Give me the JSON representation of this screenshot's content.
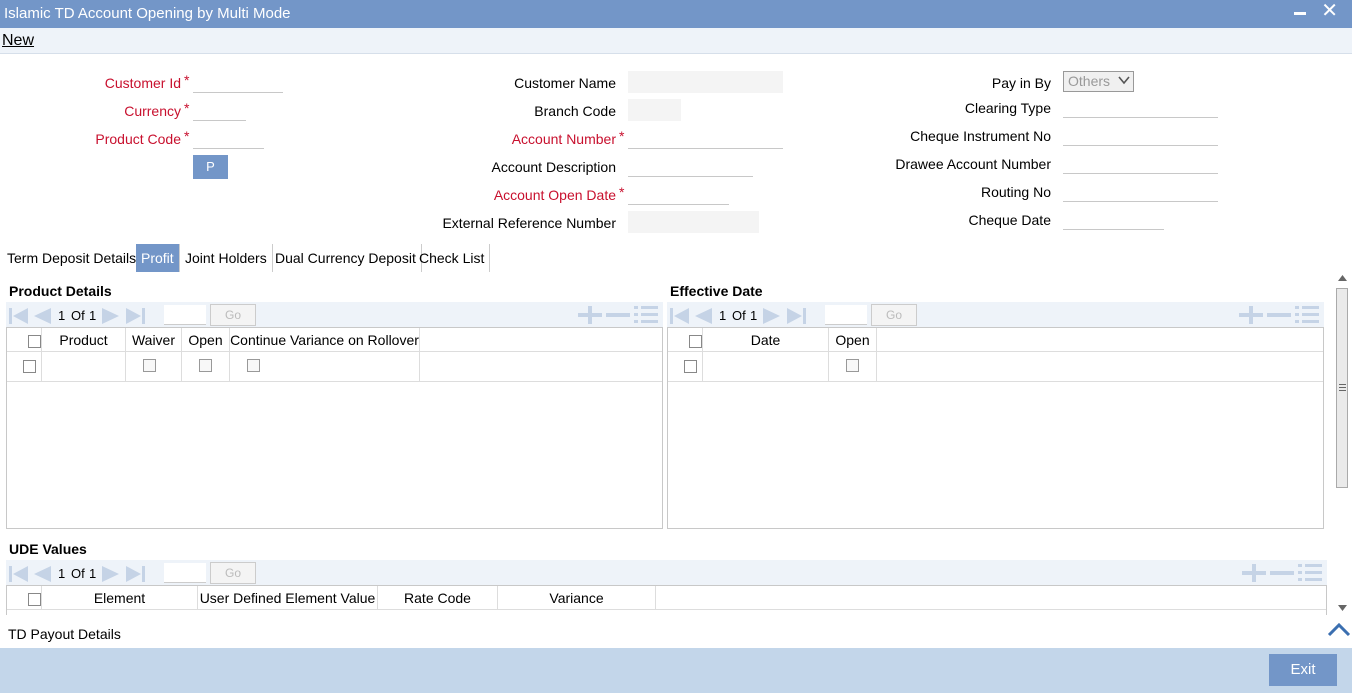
{
  "window": {
    "title": "Islamic TD Account Opening by Multi Mode"
  },
  "menu": {
    "new_label": "New"
  },
  "form": {
    "customer_id_label": "Customer Id",
    "currency_label": "Currency",
    "product_code_label": "Product Code",
    "p_button_label": "P",
    "customer_name_label": "Customer Name",
    "branch_code_label": "Branch Code",
    "account_number_label": "Account Number",
    "account_description_label": "Account Description",
    "account_open_date_label": "Account Open Date",
    "external_reference_label": "External Reference Number",
    "pay_in_by_label": "Pay in By",
    "pay_in_by_value": "Others",
    "clearing_type_label": "Clearing Type",
    "cheque_instrument_label": "Cheque Instrument No",
    "drawee_account_label": "Drawee Account Number",
    "routing_no_label": "Routing No",
    "cheque_date_label": "Cheque Date",
    "required_mark": "*"
  },
  "tabs": [
    {
      "label": "Term Deposit Details",
      "active": false
    },
    {
      "label": "Profit",
      "active": true
    },
    {
      "label": "Joint Holders",
      "active": false
    },
    {
      "label": "Dual Currency Deposit",
      "active": false
    },
    {
      "label": "Check List",
      "active": false
    }
  ],
  "product_details": {
    "title": "Product Details",
    "pager": {
      "current": "1",
      "of": "Of",
      "total": "1",
      "go": "Go"
    },
    "columns": [
      "Product",
      "Waiver",
      "Open",
      "Continue Variance on Rollover"
    ]
  },
  "effective_date": {
    "title": "Effective Date",
    "pager": {
      "current": "1",
      "of": "Of",
      "total": "1",
      "go": "Go"
    },
    "columns": [
      "Date",
      "Open"
    ]
  },
  "ude_values": {
    "title": "UDE Values",
    "pager": {
      "current": "1",
      "of": "Of",
      "total": "1",
      "go": "Go"
    },
    "columns": [
      "Element",
      "User Defined Element Value",
      "Rate Code",
      "Variance"
    ]
  },
  "footer": {
    "td_payout_label": "TD Payout Details",
    "exit_label": "Exit"
  },
  "colors": {
    "accent": "#7396c8",
    "required": "#c8102e",
    "footer": "#c3d6ea"
  }
}
